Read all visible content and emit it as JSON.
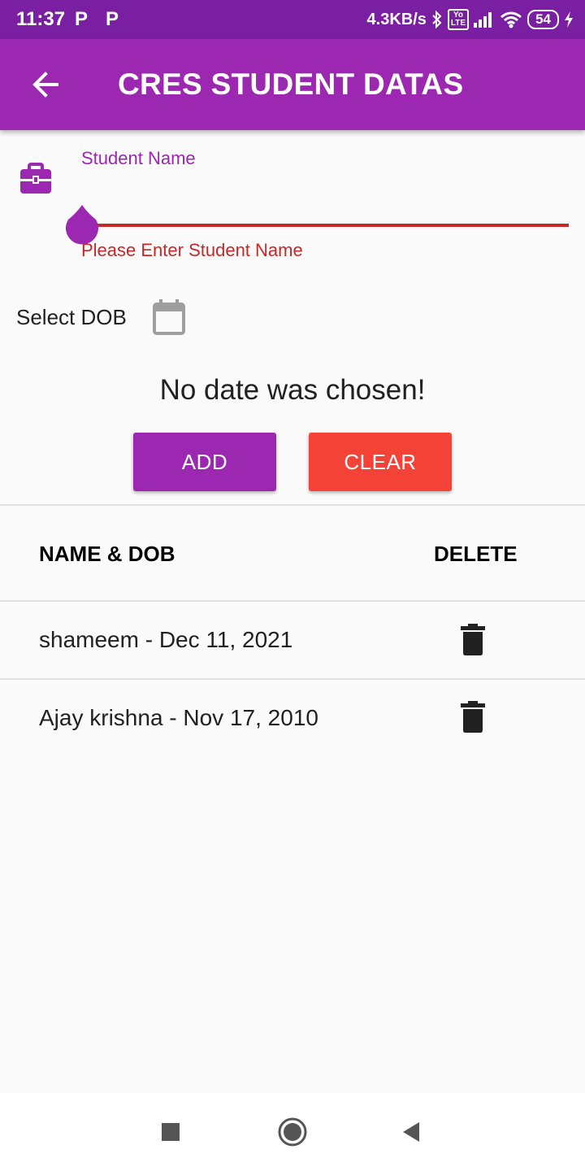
{
  "status_bar": {
    "time": "11:37",
    "notification_icons": [
      "P",
      "P"
    ],
    "speed": "4.3KB/s",
    "volte_top": "Yo",
    "volte_bottom": "LTE",
    "battery": "54"
  },
  "app_bar": {
    "title": "CRES STUDENT DATAS",
    "back_icon": "arrow-back-icon"
  },
  "form": {
    "name_icon": "briefcase-icon",
    "name_label": "Student Name",
    "name_value": "",
    "name_error": "Please Enter Student Name",
    "dob_label": "Select DOB",
    "dob_icon": "calendar-icon",
    "date_status": "No date was chosen!",
    "add_label": "ADD",
    "clear_label": "CLEAR"
  },
  "table": {
    "headers": [
      "NAME & DOB",
      "DELETE"
    ],
    "rows": [
      {
        "text": "shameem - Dec 11, 2021",
        "action_icon": "trash-icon"
      },
      {
        "text": "Ajay krishna - Nov 17, 2010",
        "action_icon": "trash-icon"
      }
    ]
  },
  "colors": {
    "primary": "#9c27b0",
    "primary_dark": "#7b1fa2",
    "error": "#c62828",
    "clear_button": "#f44336"
  },
  "nav_bar": {
    "icons": [
      "recents-square-icon",
      "home-circle-icon",
      "back-triangle-icon"
    ]
  }
}
